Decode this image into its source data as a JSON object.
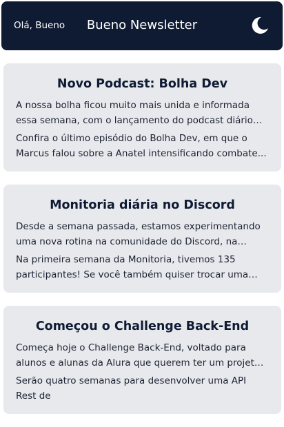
{
  "header": {
    "greeting": "Olá, Bueno",
    "title": "Bueno Newsletter",
    "theme_icon": "moon-icon"
  },
  "posts": [
    {
      "title": "Novo Podcast: Bolha Dev",
      "p1": "A nossa bolha ficou muito mais unida e informada essa semana, com o lançamento do podcast diário Bolha De...",
      "p2": "Confira o último episódio do Bolha Dev, em que o Marcus falou sobre a Anatel intensificando combate..."
    },
    {
      "title": "Monitoria diária no Discord",
      "p1": "Desde a semana passada, estamos experimentando uma nova rotina na comunidade do Discord, na escola de...",
      "p2": "Na primeira semana da Monitoria, tivemos 135 participantes! Se você também quiser trocar uma ideia..."
    },
    {
      "title": "Começou o Challenge Back-End",
      "p1": "Começa hoje o Challenge Back-End, voltado para alunos e alunas da Alura que querem ter um projeto completo...",
      "p2": "Serão quatro semanas para desenvolver uma API Rest de"
    }
  ]
}
